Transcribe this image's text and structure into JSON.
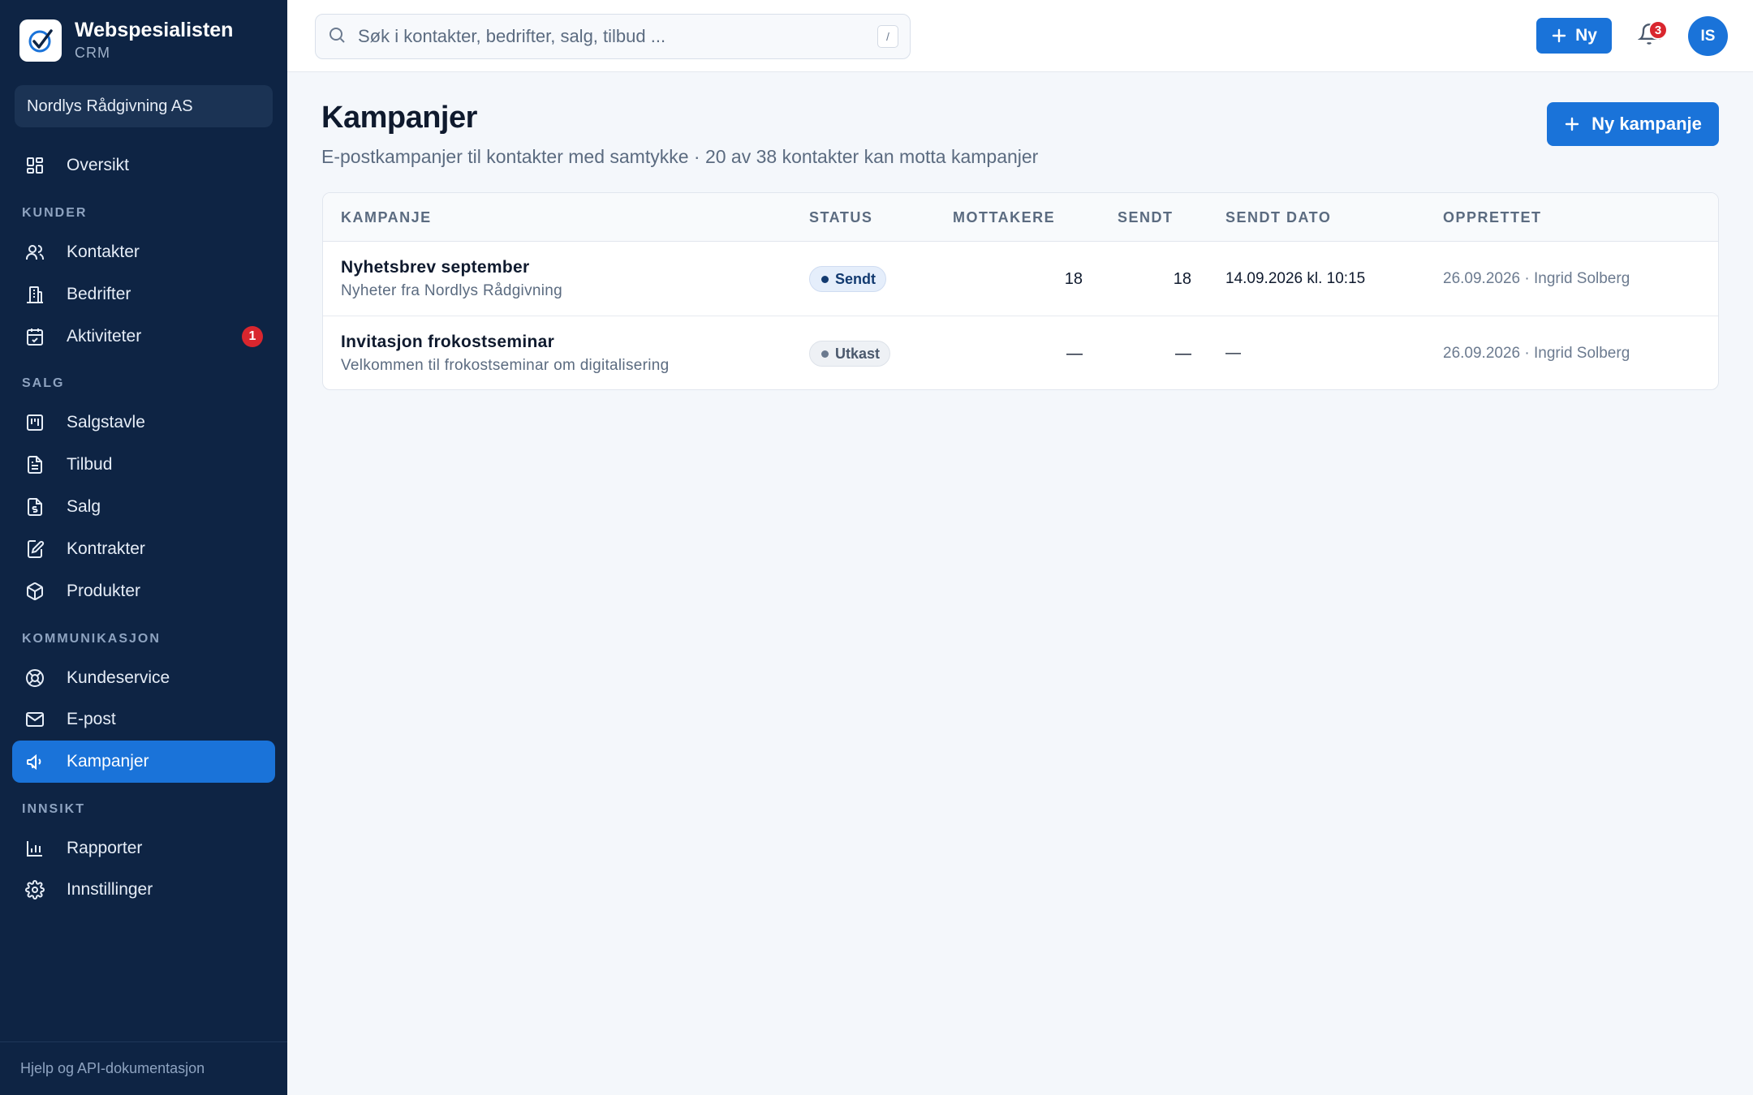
{
  "brand": {
    "name": "Webspesialisten",
    "sub": "CRM"
  },
  "org": {
    "name": "Nordlys Rådgivning AS"
  },
  "nav": {
    "overview": "Oversikt",
    "sections": {
      "customers": "KUNDER",
      "sales": "SALG",
      "communication": "KOMMUNIKASJON",
      "insight": "INNSIKT"
    },
    "items": {
      "contacts": "Kontakter",
      "companies": "Bedrifter",
      "activities": "Aktiviteter",
      "activities_badge": "1",
      "salesboard": "Salgstavle",
      "quotes": "Tilbud",
      "sales": "Salg",
      "contracts": "Kontrakter",
      "products": "Produkter",
      "support": "Kundeservice",
      "email": "E-post",
      "campaigns": "Kampanjer",
      "reports": "Rapporter",
      "settings": "Innstillinger"
    },
    "footer": "Hjelp og API-dokumentasjon"
  },
  "topbar": {
    "search_placeholder": "Søk i kontakter, bedrifter, salg, tilbud ...",
    "search_shortcut": "/",
    "new_label": "Ny",
    "notifications_count": "3",
    "avatar_initials": "IS"
  },
  "page": {
    "title": "Kampanjer",
    "subtitle": "E-postkampanjer til kontakter med samtykke · 20 av 38 kontakter kan motta kampanjer",
    "new_campaign_label": "Ny kampanje"
  },
  "table": {
    "headers": [
      "KAMPANJE",
      "STATUS",
      "MOTTAKERE",
      "SENDT",
      "SENDT DATO",
      "OPPRETTET"
    ],
    "rows": [
      {
        "name": "Nyhetsbrev september",
        "description": "Nyheter fra Nordlys Rådgivning",
        "status": "Sendt",
        "recipients": "18",
        "sent": "18",
        "sent_date": "14.09.2026 kl. 10:15",
        "created": "26.09.2026 · Ingrid Solberg"
      },
      {
        "name": "Invitasjon frokostseminar",
        "description": "Velkommen til frokostseminar om digitalisering",
        "status": "Utkast",
        "recipients": "—",
        "sent": "—",
        "sent_date": "—",
        "created": "26.09.2026 · Ingrid Solberg"
      }
    ]
  },
  "colors": {
    "sidebar": "#0e2444",
    "accent": "#1a73d9",
    "badge": "#d9262e",
    "background": "#f4f7fb"
  }
}
